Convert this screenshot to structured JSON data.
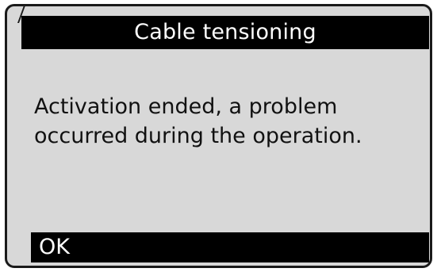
{
  "dialog": {
    "title": "Cable tensioning",
    "message": "Activation ended, a problem\noccurred during the operation.",
    "ok_label": "OK"
  },
  "colors": {
    "screen_background": "#d8d8d8",
    "bar_background": "#000000",
    "bar_text": "#ffffff",
    "body_text": "#111111"
  }
}
